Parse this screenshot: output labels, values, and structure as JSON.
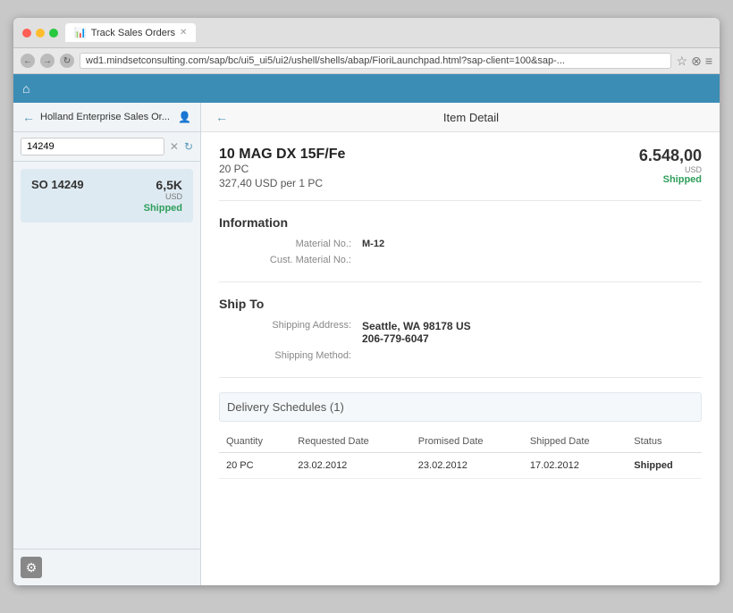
{
  "browser": {
    "tab_title": "Track Sales Orders",
    "address_bar": "wd1.mindsetconsulting.com/sap/bc/ui5_ui5/ui2/ushell/shells/abap/FioriLaunchpad.html?sap-client=100&sap-..."
  },
  "app": {
    "header": {
      "home_icon": "⌂"
    },
    "left_panel": {
      "title": "Holland Enterprise Sales Or...",
      "search_value": "14249",
      "so_card": {
        "number": "SO 14249",
        "amount": "6,5K",
        "currency": "USD",
        "status": "Shipped"
      },
      "settings_icon": "⚙"
    },
    "right_panel": {
      "title": "Item Detail",
      "item": {
        "name": "10 MAG DX 15F/Fe",
        "price": "6.548,00",
        "currency": "USD",
        "status": "Shipped",
        "quantity": "20 PC",
        "unit_price": "327,40 USD per 1 PC"
      },
      "information": {
        "section_title": "Information",
        "material_no_label": "Material No.:",
        "material_no_value": "M-12",
        "cust_material_no_label": "Cust. Material No.:"
      },
      "ship_to": {
        "section_title": "Ship To",
        "shipping_address_label": "Shipping Address:",
        "address_line1": "Seattle, WA 98178 US",
        "address_line2": "206-779-6047",
        "shipping_method_label": "Shipping Method:"
      },
      "delivery_schedules": {
        "title": "Delivery Schedules (1)",
        "columns": [
          "Quantity",
          "Requested Date",
          "Promised Date",
          "Shipped Date",
          "Status"
        ],
        "rows": [
          {
            "quantity": "20 PC",
            "requested_date": "23.02.2012",
            "promised_date": "23.02.2012",
            "shipped_date": "17.02.2012",
            "status": "Shipped"
          }
        ]
      }
    }
  }
}
